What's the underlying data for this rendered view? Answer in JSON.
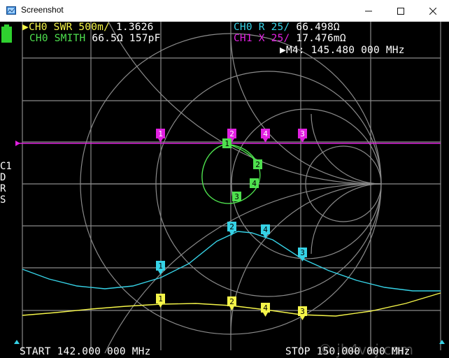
{
  "window": {
    "title": "Screenshot",
    "controls": [
      "minimize",
      "maximize",
      "close"
    ]
  },
  "traces": {
    "ch0_swr": {
      "label": "CH0 SWR 500m/",
      "value": "1.3626"
    },
    "ch0_smith": {
      "label": "CH0 SMITH",
      "value": "66.5Ω 157pF"
    },
    "ch0_r": {
      "label": "CH0 R 25/",
      "value": "66.498Ω"
    },
    "ch1_x": {
      "label": "CH1 X 25/",
      "value": "17.476mΩ"
    }
  },
  "active_marker": {
    "label": "M4:",
    "value": "145.480 000 MHz"
  },
  "side_menu": [
    "C1",
    "D",
    "R",
    "S"
  ],
  "footer": {
    "start": "START 142.000 000 MHz",
    "stop": "STOP 150.000 000 MHz",
    "watermark": "© jh4vaj.com"
  },
  "markers": {
    "magenta": [
      "1",
      "2",
      "4",
      "3"
    ],
    "green": [
      "1",
      "2",
      "4",
      "3"
    ],
    "cyan": [
      "1",
      "2",
      "4",
      "3"
    ],
    "yellow": [
      "1",
      "2",
      "4",
      "3"
    ]
  },
  "colors": {
    "background": "#000000",
    "grid": "#808080",
    "swr": "#f5f549",
    "smith": "#4ee04e",
    "resistance": "#36d2e6",
    "reactance": "#e020e0",
    "text": "#ffffff"
  }
}
